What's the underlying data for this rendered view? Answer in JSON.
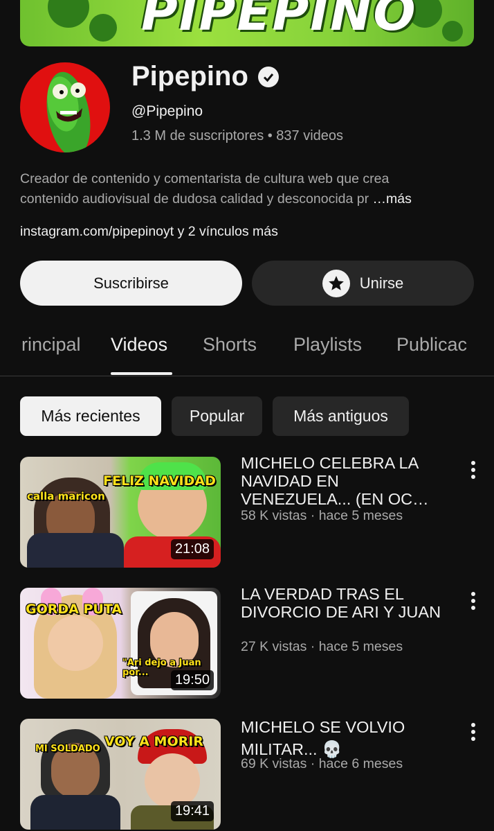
{
  "banner": {
    "text": "PIPEPINO"
  },
  "channel": {
    "name": "Pipepino",
    "handle": "@Pipepino",
    "stats": "1.3 M de suscriptores • 837 videos",
    "description_line1": "Creador de contenido y comentarista de cultura web que crea",
    "description_line2": "contenido audiovisual de dudosa calidad y desconocida pr",
    "more_label": "…más",
    "links": "instagram.com/pipepinoyt y 2 vínculos más"
  },
  "buttons": {
    "subscribe": "Suscribirse",
    "join": "Unirse"
  },
  "tabs": [
    {
      "label": "rincipal",
      "active": false
    },
    {
      "label": "Videos",
      "active": true
    },
    {
      "label": "Shorts",
      "active": false
    },
    {
      "label": "Playlists",
      "active": false
    },
    {
      "label": "Publicac",
      "active": false
    }
  ],
  "filters": [
    "Más recientes",
    "Popular",
    "Más antiguos"
  ],
  "videos": [
    {
      "title": "MICHELO CELEBRA LA NAVIDAD EN VENEZUELA... (EN OC…",
      "meta": "58 K vistas · hace 5 meses",
      "duration": "21:08",
      "thumb_text_1": "calla maricon",
      "thumb_text_2": "FELIZ NAVIDAD"
    },
    {
      "title": "LA VERDAD TRAS EL DIVORCIO DE ARI Y JUAN",
      "meta": "27 K vistas · hace 5 meses",
      "duration": "19:50",
      "thumb_text_1": "GORDA PUTA",
      "thumb_text_2": "\"Ari dejo a Juan por..."
    },
    {
      "title": "MICHELO SE VOLVIO MILITAR... 💀",
      "meta": "69 K vistas · hace 6 meses",
      "duration": "19:41",
      "thumb_text_1": "MI SOLDADO",
      "thumb_text_2": "VOY A MORIR"
    }
  ],
  "colors": {
    "background": "#0f0f0f",
    "text_primary": "#f1f1f1",
    "text_secondary": "#aaaaaa",
    "chip_dark": "#272727",
    "thumb_label": "#ffe21a"
  },
  "icons": [
    "verified-check-icon",
    "star-icon",
    "more-vertical-icon"
  ]
}
